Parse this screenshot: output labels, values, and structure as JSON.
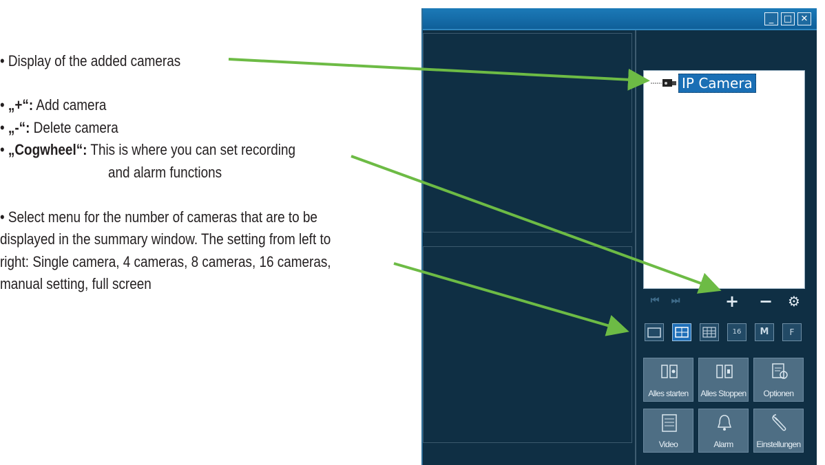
{
  "annotations": {
    "display_cameras": "• Display of the added cameras",
    "add_key": "„+“:",
    "add_text": "Add camera",
    "delete_key": "„-“:",
    "delete_text": "Delete camera",
    "cog_key": "„Cogwheel“:",
    "cog_text_1": "This is where you can set recording",
    "cog_text_2": "and alarm functions",
    "select_1": "• Select menu for the number of cameras that are to be",
    "select_2": "displayed in the summary window. The setting from left to",
    "select_3": "right: Single camera, 4 cameras, 8 cameras, 16 cameras,",
    "select_4": "manual setting, full screen",
    "bullet": "•"
  },
  "window": {
    "minimize_glyph": "_",
    "maximize_glyph": "□",
    "close_glyph": "✕"
  },
  "camera_tree": {
    "selected_item": "IP Camera"
  },
  "controls": {
    "prev_glyph": "⏮",
    "next_glyph": "⏭",
    "add_glyph": "+",
    "remove_glyph": "−",
    "settings_glyph": "⚙"
  },
  "layout_buttons": {
    "sixteen": "16",
    "manual": "M",
    "fullscreen": "F"
  },
  "actions": {
    "start_all": "Alles starten",
    "stop_all": "Alles Stoppen",
    "options": "Optionen",
    "video": "Video",
    "alarm": "Alarm",
    "settings": "Einstellungen"
  },
  "colors": {
    "window_bg": "#0f2f44",
    "title_bar": "#1c7ab8",
    "arrow": "#6dbb45",
    "selection": "#1a6fb5"
  }
}
